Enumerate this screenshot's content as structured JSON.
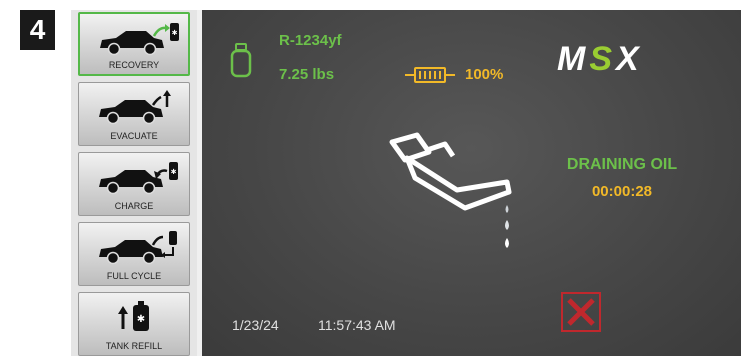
{
  "step_number": "4",
  "sidebar": {
    "items": [
      {
        "label": "RECOVERY",
        "icon": "car-recovery-icon",
        "active": true
      },
      {
        "label": "EVACUATE",
        "icon": "car-evacuate-icon",
        "active": false
      },
      {
        "label": "CHARGE",
        "icon": "car-charge-icon",
        "active": false
      },
      {
        "label": "FULL CYCLE",
        "icon": "car-full-cycle-icon",
        "active": false
      },
      {
        "label": "TANK REFILL",
        "icon": "tank-refill-icon",
        "active": false
      }
    ]
  },
  "status_bar": {
    "refrigerant": "R-1234yf",
    "tank_weight": "7.25 lbs",
    "battery_percent": "100%"
  },
  "logo": {
    "part1": "M",
    "part2": "S",
    "part3": "X"
  },
  "main": {
    "status": "DRAINING OIL",
    "timer": "00:00:28"
  },
  "footer": {
    "date": "1/23/24",
    "time": "11:57:43 AM"
  },
  "colors": {
    "accent_green": "#6cc04a",
    "accent_yellow": "#f2b928",
    "cancel_red": "#c0282d"
  }
}
